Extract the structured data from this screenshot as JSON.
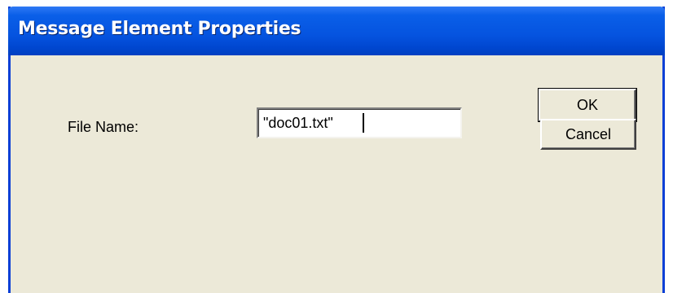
{
  "window": {
    "title": "Message Element Properties"
  },
  "form": {
    "file_name_label": "File Name:",
    "file_name_value": "\"doc01.txt\""
  },
  "buttons": {
    "ok_label": "OK",
    "cancel_label": "Cancel"
  },
  "colors": {
    "titlebar": "#0553df",
    "dialog_background": "#ece9d8",
    "title_text": "#ffffff"
  }
}
